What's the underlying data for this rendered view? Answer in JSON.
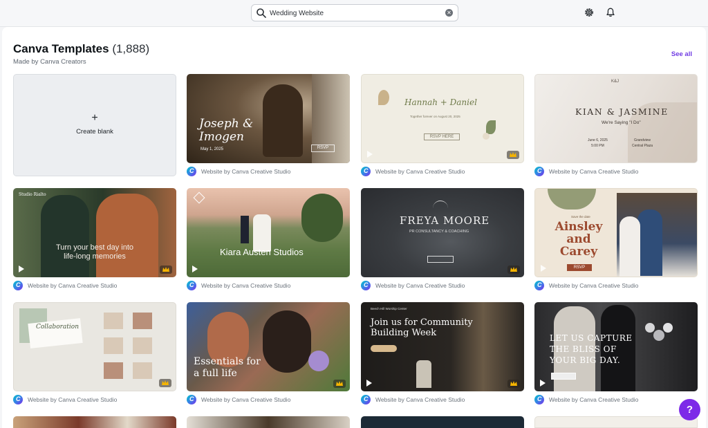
{
  "search": {
    "value": "Wedding Website"
  },
  "section": {
    "title": "Canva Templates",
    "count": "(1,888)",
    "subtitle": "Made by Canva Creators",
    "see_all": "See all"
  },
  "create_blank": {
    "plus": "+",
    "label": "Create blank"
  },
  "caption": "Website by Canva Creative Studio",
  "logo_letter": "C",
  "help": {
    "label": "?"
  },
  "colors": {
    "accent": "#7d2ae8",
    "see_all": "#6f3ae3",
    "background": "#f4f5f7"
  },
  "templates": {
    "joseph": {
      "title": "Joseph &\nImogen",
      "date": "May 1, 2025",
      "rsvp": "RSVP"
    },
    "hannah": {
      "title": "Hannah + Daniel",
      "small": "Together forever on August 20, 2025",
      "button": "RSVP HERE"
    },
    "kian": {
      "top": "K&J",
      "title": "KIAN & JASMINE",
      "sub": "We're Saying \"I Do\"",
      "left": "June 6, 2025\n5:00 PM",
      "right": "Grandview\nCentral Plaza"
    },
    "studio_rialto": {
      "brand": "Studio Rialto",
      "title": "Turn your best day into\nlife-long memories"
    },
    "kiara": {
      "title": "Kiara Austen Studios"
    },
    "freya": {
      "title": "FREYA MOORE",
      "sub": "PR CONSULTANCY & COACHING"
    },
    "ainsley": {
      "save": "Save the date",
      "title": "Ainsley\nand\nCarey",
      "button": "RSVP"
    },
    "collage": {
      "title": "Collaboration"
    },
    "essentials": {
      "title": "Essentials for\na full life"
    },
    "community": {
      "small": "Beech Hill Worship Center",
      "title": "Join us for Community\nBuilding Week"
    },
    "capture": {
      "title": "LET US CAPTURE\nTHE BLISS OF\nYOUR BIG DAY."
    }
  }
}
